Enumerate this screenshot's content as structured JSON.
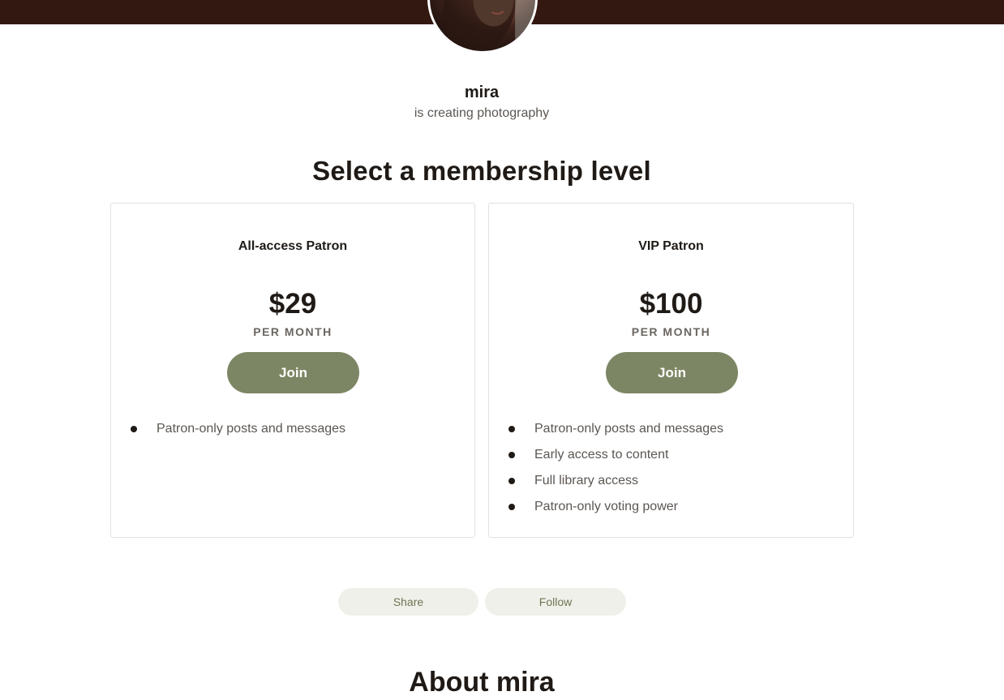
{
  "header": {
    "banner_color": "#331811"
  },
  "creator": {
    "name": "mira",
    "tagline": "is creating photography"
  },
  "membership": {
    "title": "Select a membership level",
    "tiers": [
      {
        "name": "All-access Patron",
        "price": "$29",
        "period": "PER MONTH",
        "join_label": "Join",
        "benefits": [
          "Patron-only posts and messages"
        ]
      },
      {
        "name": "VIP Patron",
        "price": "$100",
        "period": "PER MONTH",
        "join_label": "Join",
        "benefits": [
          "Patron-only posts and messages",
          "Early access to content",
          "Full library access",
          "Patron-only voting power"
        ]
      }
    ]
  },
  "actions": {
    "share_label": "Share",
    "follow_label": "Follow"
  },
  "about": {
    "title": "About mira"
  },
  "colors": {
    "accent": "#7d8664",
    "pill_bg": "#f0f0ea",
    "text": "#1f1a16"
  }
}
